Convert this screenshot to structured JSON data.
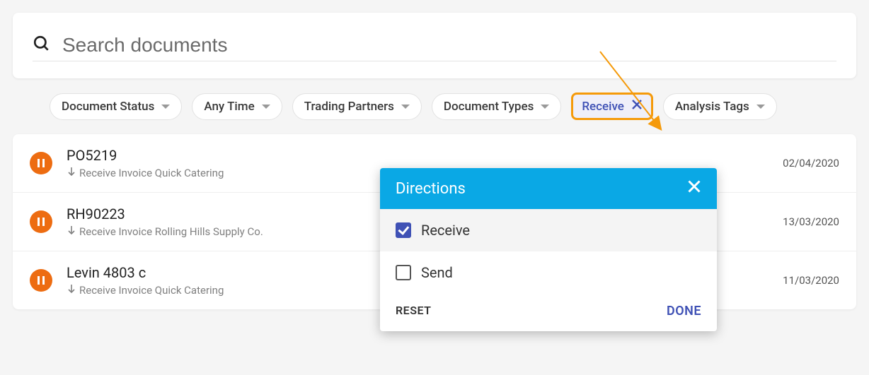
{
  "search": {
    "placeholder": "Search documents"
  },
  "filters": {
    "status": "Document Status",
    "time": "Any Time",
    "partners": "Trading Partners",
    "types": "Document Types",
    "direction": "Receive",
    "tags": "Analysis Tags"
  },
  "popup": {
    "title": "Directions",
    "options": {
      "receive": "Receive",
      "send": "Send"
    },
    "reset": "RESET",
    "done": "DONE"
  },
  "docs": [
    {
      "id": "PO5219",
      "sub": "Receive Invoice Quick Catering",
      "date": "02/04/2020"
    },
    {
      "id": "RH90223",
      "sub": "Receive Invoice Rolling Hills Supply Co.",
      "date": "13/03/2020"
    },
    {
      "id": "Levin 4803 c",
      "sub": "Receive Invoice Quick Catering",
      "date": "11/03/2020"
    }
  ]
}
